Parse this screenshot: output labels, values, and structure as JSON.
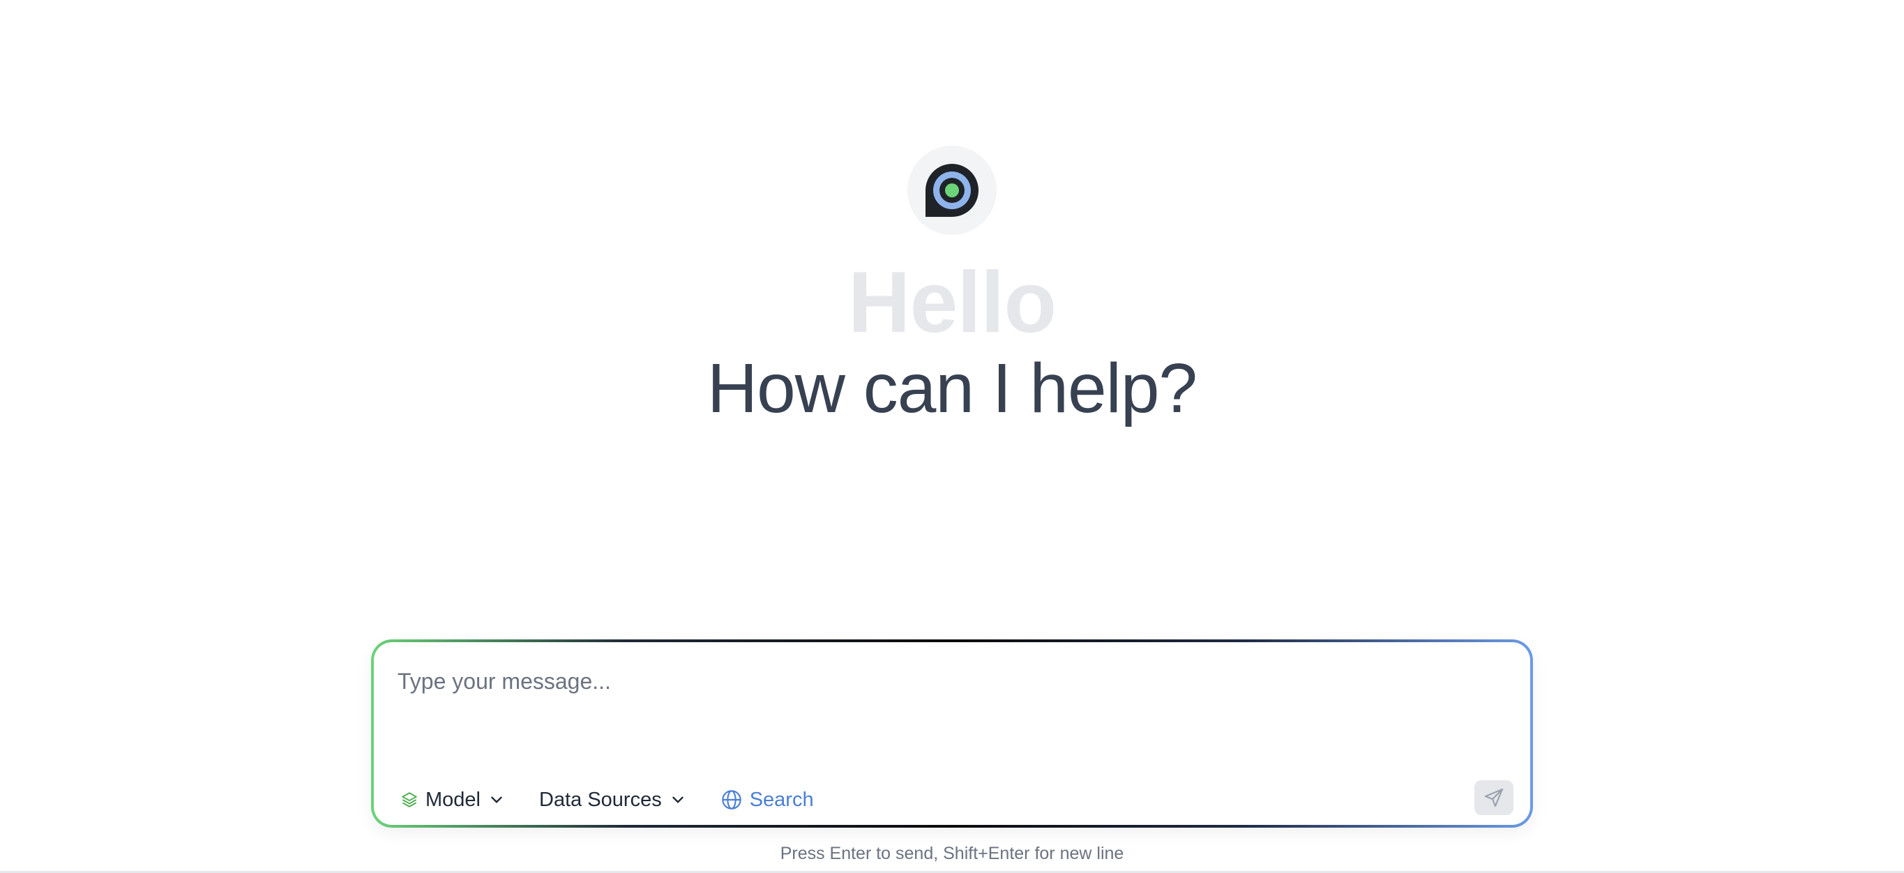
{
  "brand": {
    "logo_icon": "chat-bubble-target-icon",
    "colors": {
      "ring_outer": "#1f2328",
      "ring_inner": "#8fb4ec",
      "dot": "#6bd47a",
      "logo_bg": "#f3f4f6"
    }
  },
  "hero": {
    "greeting": "Hello",
    "headline": "How can I help?"
  },
  "composer": {
    "placeholder": "Type your message...",
    "value": "",
    "toolbar": {
      "model_label": "Model",
      "data_sources_label": "Data Sources",
      "search_label": "Search"
    },
    "send_icon": "send-icon",
    "gradient_colors": [
      "#6bd47a",
      "#0b0b0b",
      "#6b9be6"
    ]
  },
  "footer": {
    "hint": "Press Enter to send, Shift+Enter for new line"
  }
}
